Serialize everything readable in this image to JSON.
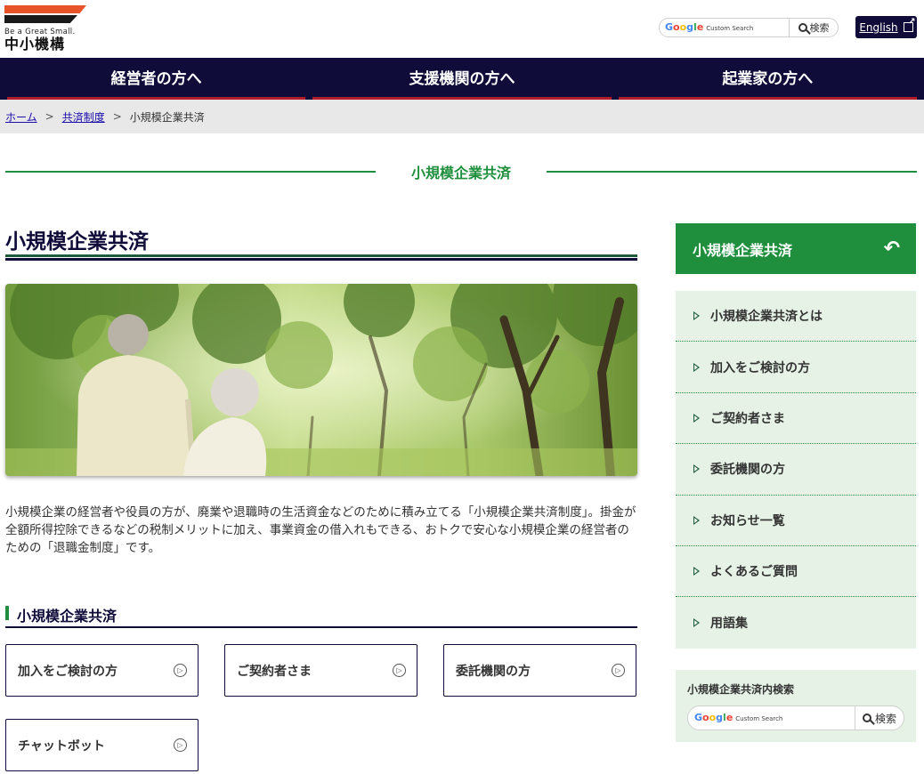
{
  "header": {
    "logo_tagline": "Be a Great Small.",
    "logo_name": "中小機構",
    "search_brand": "Google",
    "search_brand_sub": "Custom Search",
    "search_button": "検索",
    "english_label": "English"
  },
  "gnav": {
    "items": [
      "経営者の方へ",
      "支援機関の方へ",
      "起業家の方へ"
    ]
  },
  "breadcrumb": {
    "home": "ホーム",
    "sep": ">",
    "parent": "共済制度",
    "current": "小規模企業共済"
  },
  "section_heading": "小規模企業共済",
  "main": {
    "title": "小規模企業共済",
    "intro": "小規模企業の経営者や役員の方が、廃業や退職時の生活資金などのために積み立てる「小規模企業共済制度」。掛金が全額所得控除できるなどの税制メリットに加え、事業資金の借入れもできる、おトクで安心な小規模企業の経営者のための「退職金制度」です。",
    "subheading": "小規模企業共済",
    "cards": [
      "加入をご検討の方",
      "ご契約者さま",
      "委託機関の方",
      "チャットボット"
    ]
  },
  "sidebar": {
    "head": "小規模企業共済",
    "items": [
      "小規模企業共済とは",
      "加入をご検討の方",
      "ご契約者さま",
      "委託機関の方",
      "お知らせ一覧",
      "よくあるご質問",
      "用語集"
    ],
    "search_label": "小規模企業共済内検索",
    "search_button": "検索"
  },
  "colors": {
    "navy": "#0f0c3a",
    "green": "#1f8f3d",
    "accent_red": "#b41c2a",
    "logo_orange": "#e8542a",
    "sidebar_bg": "#e6f2e6"
  },
  "icons": [
    "search-icon",
    "external-link-icon",
    "back-arrow-icon",
    "chevron-right-icon",
    "circle-arrow-icon"
  ]
}
